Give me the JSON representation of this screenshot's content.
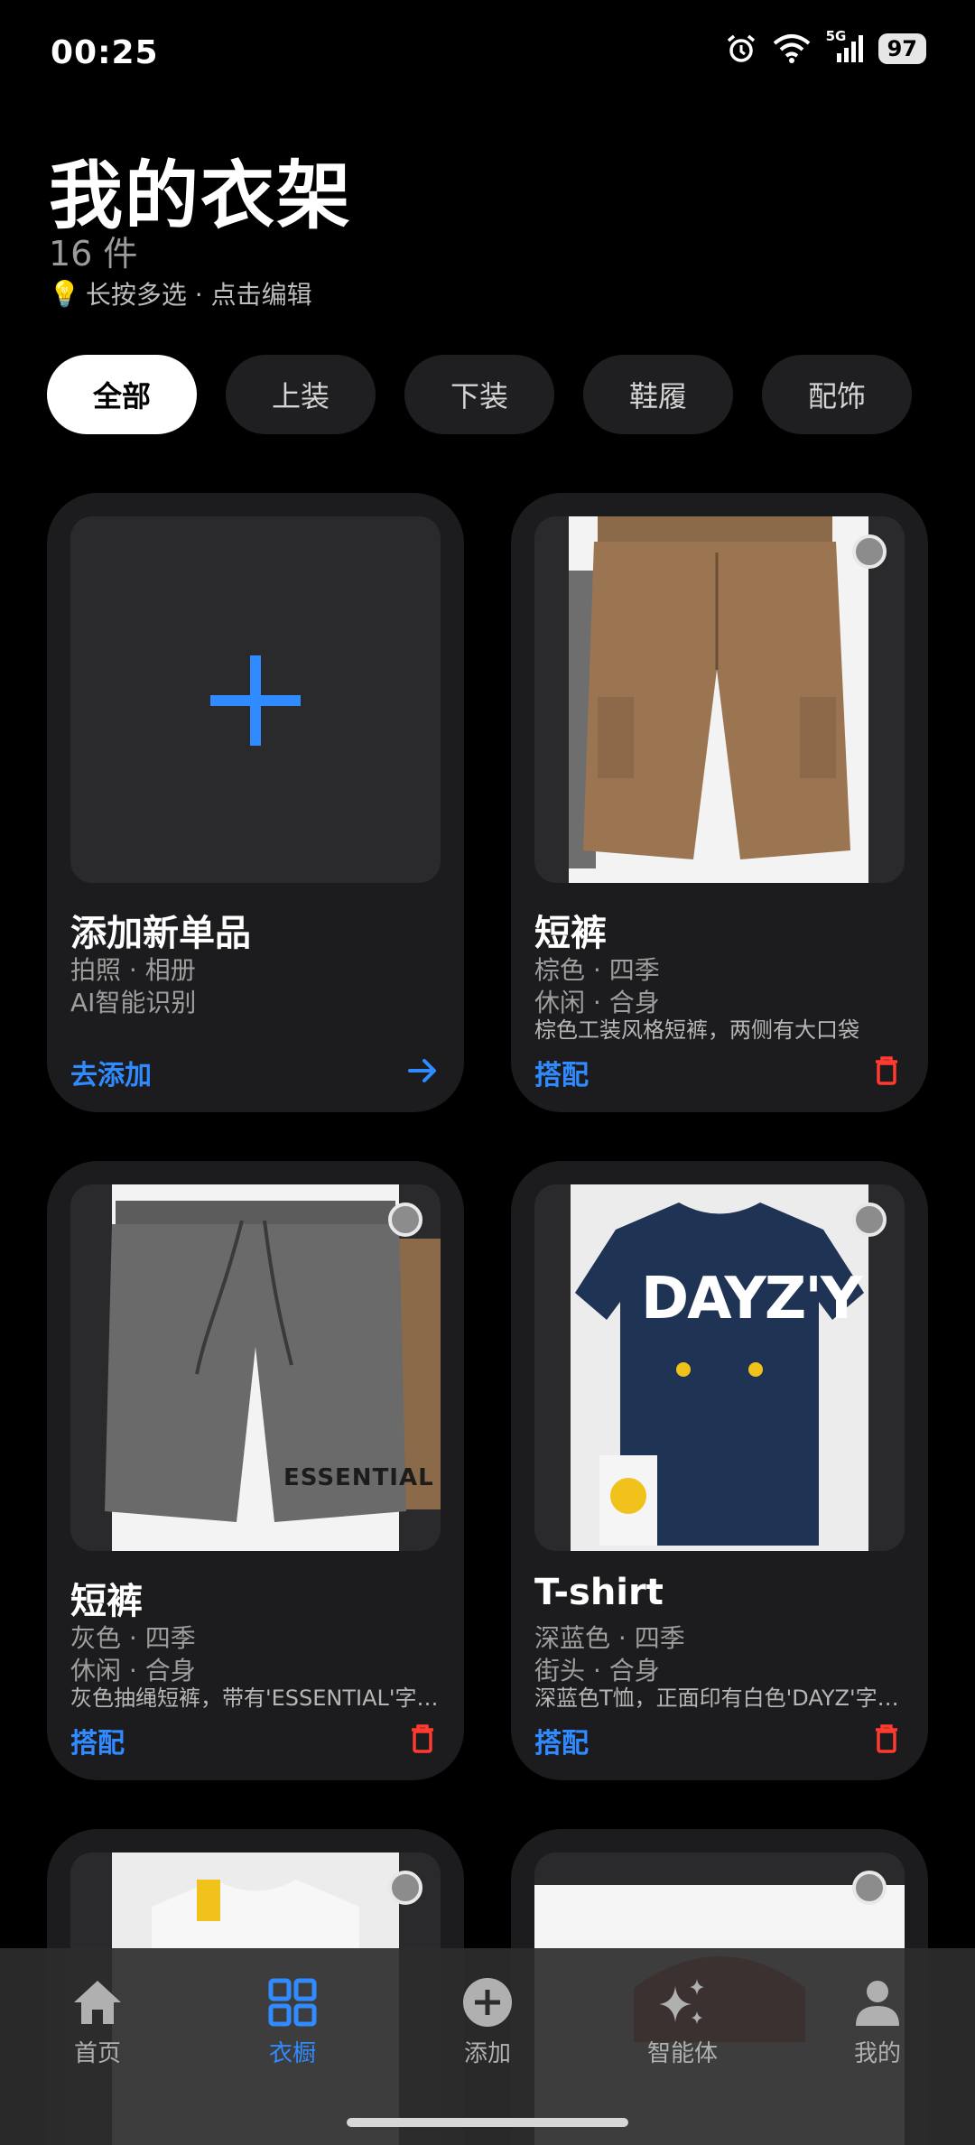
{
  "status": {
    "time": "00:25",
    "network": "5G",
    "battery": "97"
  },
  "header": {
    "title": "我的衣架",
    "count": "16 件",
    "hint_icon": "lightbulb-icon",
    "hint": "长按多选 · 点击编辑"
  },
  "filters": [
    {
      "label": "全部",
      "active": true
    },
    {
      "label": "上装",
      "active": false
    },
    {
      "label": "下装",
      "active": false
    },
    {
      "label": "鞋履",
      "active": false
    },
    {
      "label": "配饰",
      "active": false
    }
  ],
  "add_card": {
    "title": "添加新单品",
    "line1": "拍照 · 相册",
    "line2": "AI智能识别",
    "action": "去添加"
  },
  "items": [
    {
      "title": "短裤",
      "line1": "棕色 · 四季",
      "line2": "休闲 · 合身",
      "desc": "棕色工装风格短裤，两侧有大口袋",
      "action": "搭配"
    },
    {
      "title": "短裤",
      "line1": "灰色 · 四季",
      "line2": "休闲 · 合身",
      "desc": "灰色抽绳短裤，带有'ESSENTIAL'字样的标志",
      "print": "ESSENTIAL",
      "action": "搭配"
    },
    {
      "title": "T-shirt",
      "line1": "深蓝色 · 四季",
      "line2": "街头 · 合身",
      "desc": "深蓝色T恤，正面印有白色'DAYZ'字样图案",
      "print": "DAYZ'Y",
      "action": "搭配"
    }
  ],
  "nav": [
    {
      "label": "首页",
      "icon": "home-icon",
      "active": false
    },
    {
      "label": "衣橱",
      "icon": "grid-icon",
      "active": true
    },
    {
      "label": "添加",
      "icon": "plus-circle-icon",
      "active": false
    },
    {
      "label": "智能体",
      "icon": "sparkle-icon",
      "active": false
    },
    {
      "label": "我的",
      "icon": "person-icon",
      "active": false
    }
  ],
  "colors": {
    "accent": "#2f8bff",
    "danger": "#ff3b30",
    "card_bg": "#1c1c1e",
    "page_bg": "#000000"
  }
}
